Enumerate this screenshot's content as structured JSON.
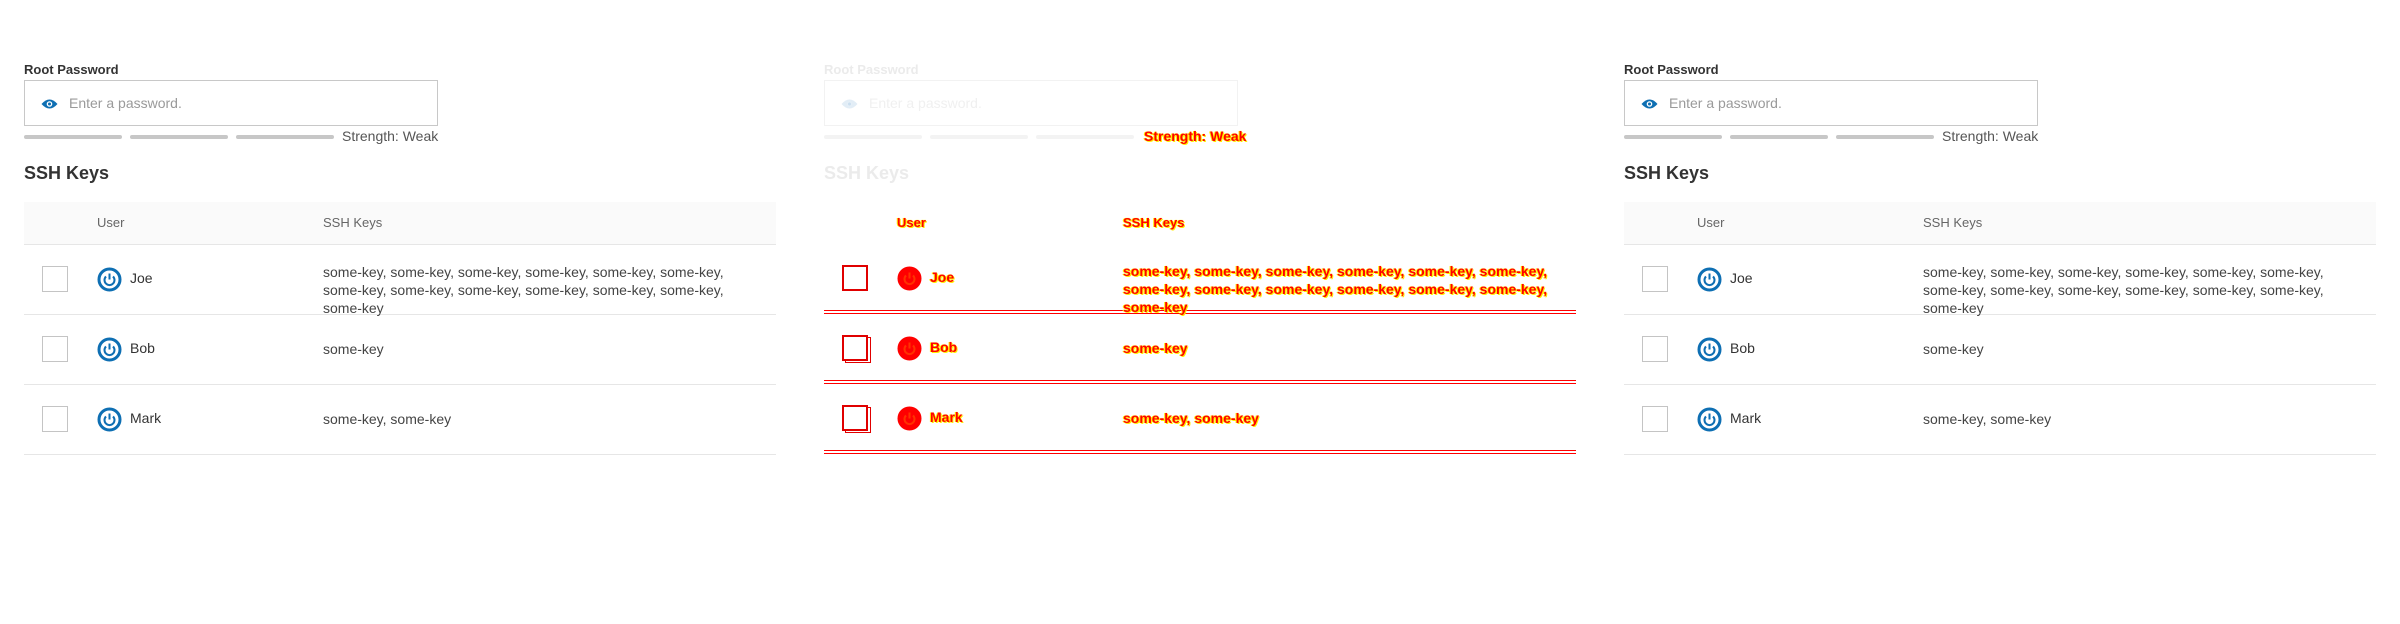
{
  "password": {
    "label": "Root Password",
    "placeholder": "Enter a password.",
    "value": "",
    "strength_text": "Strength: Weak",
    "strength_segments": 3
  },
  "ssh": {
    "title": "SSH Keys",
    "columns": {
      "user": "User",
      "keys": "SSH Keys"
    },
    "rows": [
      {
        "user": "Joe",
        "keys": "some-key, some-key, some-key, some-key, some-key, some-key, some-key, some-key, some-key, some-key, some-key, some-key, some-key"
      },
      {
        "user": "Bob",
        "keys": "some-key"
      },
      {
        "user": "Mark",
        "keys": "some-key, some-key"
      }
    ]
  },
  "colors": {
    "accent": "#0e6fb3",
    "diff_highlight": "#ff0000",
    "diff_outline": "#ffee00",
    "border": "#c8c8c8"
  }
}
